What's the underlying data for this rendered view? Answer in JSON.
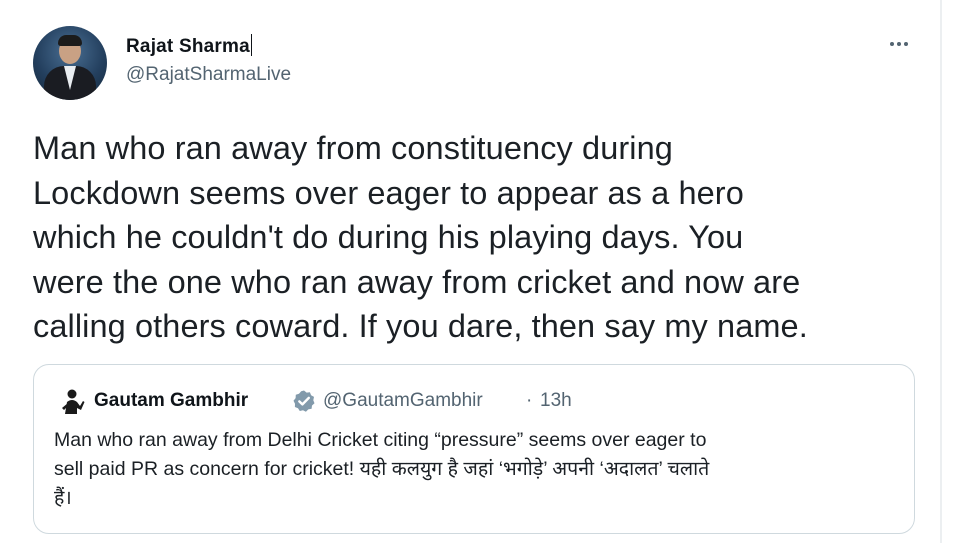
{
  "tweet": {
    "author": {
      "display_name": "Rajat Sharma",
      "handle": "@RajatSharmaLive"
    },
    "menu_icon": "more-horizontal-icon",
    "text_lines": [
      "Man who ran away from constituency during",
      "Lockdown seems over eager to appear as a hero",
      "which he couldn't do during his playing days. You",
      "were the one who ran away from cricket and now are",
      "calling others coward. If you dare, then say my name."
    ]
  },
  "quoted_tweet": {
    "author": {
      "display_name": "Gautam Gambhir",
      "handle": "@GautamGambhir",
      "separator": "·",
      "time": "13h",
      "verified": true,
      "verified_color": "#829aab"
    },
    "text_lines": [
      "Man who ran away from Delhi Cricket citing “pressure” seems over eager to",
      "sell paid PR as concern for cricket! यही कलयुग है जहां ‘भगोड़े’ अपनी ‘अदालत’ चलाते",
      "हैं।"
    ]
  }
}
